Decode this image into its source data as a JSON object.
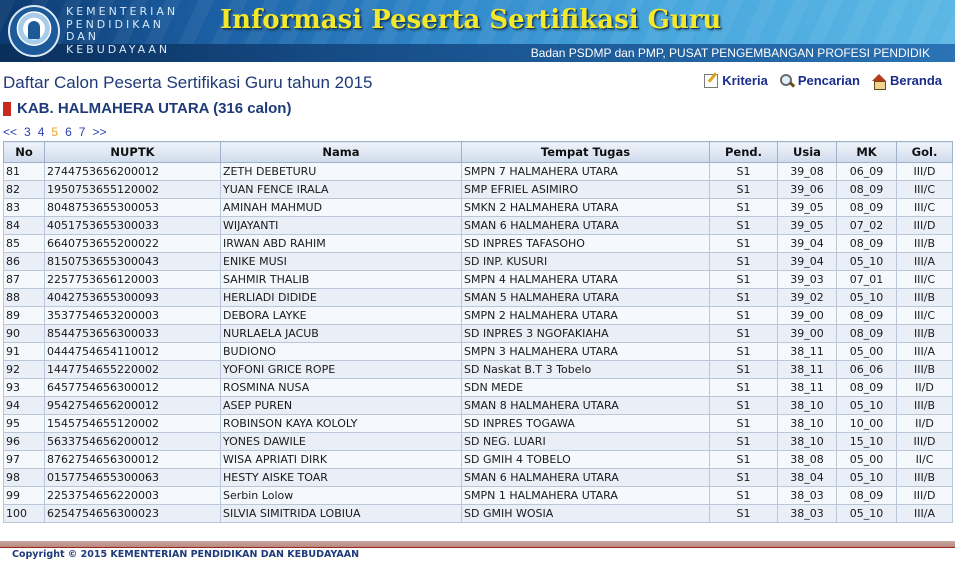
{
  "banner": {
    "ministry_lines": [
      "KEMENTERIAN",
      "PENDIDIKAN",
      "DAN",
      "KEBUDAYAAN"
    ],
    "title": "Informasi Peserta Sertifikasi Guru",
    "subtitle": "Badan PSDMP dan PMP, PUSAT PENGEMBANGAN PROFESI PENDIDIK"
  },
  "page": {
    "title": "Daftar Calon Peserta Sertifikasi Guru tahun 2015",
    "region": "KAB. HALMAHERA UTARA (316 calon)"
  },
  "nav": {
    "kriteria": "Kriteria",
    "pencarian": "Pencarian",
    "beranda": "Beranda"
  },
  "pager": {
    "prev": "<<",
    "pages": [
      "3",
      "4",
      "5",
      "6",
      "7"
    ],
    "current": "5",
    "next": ">>"
  },
  "table": {
    "headers": [
      "No",
      "NUPTK",
      "Nama",
      "Tempat Tugas",
      "Pend.",
      "Usia",
      "MK",
      "Gol."
    ],
    "rows": [
      [
        "81",
        "2744753656200012",
        "ZETH DEBETURU",
        "SMPN 7 HALMAHERA UTARA",
        "S1",
        "39_08",
        "06_09",
        "III/D"
      ],
      [
        "82",
        "1950753655120002",
        "YUAN FENCE IRALA",
        "SMP EFRIEL ASIMIRO",
        "S1",
        "39_06",
        "08_09",
        "III/C"
      ],
      [
        "83",
        "8048753655300053",
        "AMINAH MAHMUD",
        "SMKN 2 HALMAHERA UTARA",
        "S1",
        "39_05",
        "08_09",
        "III/C"
      ],
      [
        "84",
        "4051753655300033",
        "WIJAYANTI",
        "SMAN 6 HALMAHERA UTARA",
        "S1",
        "39_05",
        "07_02",
        "III/D"
      ],
      [
        "85",
        "6640753655200022",
        "IRWAN ABD RAHIM",
        "SD INPRES TAFASOHO",
        "S1",
        "39_04",
        "08_09",
        "III/B"
      ],
      [
        "86",
        "8150753655300043",
        "ENIKE MUSI",
        "SD INP. KUSURI",
        "S1",
        "39_04",
        "05_10",
        "III/A"
      ],
      [
        "87",
        "2257753656120003",
        "SAHMIR THALIB",
        "SMPN 4 HALMAHERA UTARA",
        "S1",
        "39_03",
        "07_01",
        "III/C"
      ],
      [
        "88",
        "4042753655300093",
        "HERLIADI DIDIDE",
        "SMAN 5 HALMAHERA UTARA",
        "S1",
        "39_02",
        "05_10",
        "III/B"
      ],
      [
        "89",
        "3537754653200003",
        "DEBORA LAYKE",
        "SMPN 2 HALMAHERA UTARA",
        "S1",
        "39_00",
        "08_09",
        "III/C"
      ],
      [
        "90",
        "8544753656300033",
        "NURLAELA JACUB",
        "SD INPRES 3 NGOFAKIAHA",
        "S1",
        "39_00",
        "08_09",
        "III/B"
      ],
      [
        "91",
        "0444754654110012",
        "BUDIONO",
        "SMPN 3 HALMAHERA UTARA",
        "S1",
        "38_11",
        "05_00",
        "III/A"
      ],
      [
        "92",
        "1447754655220002",
        "YOFONI GRICE ROPE",
        "SD Naskat B.T 3 Tobelo",
        "S1",
        "38_11",
        "06_06",
        "III/B"
      ],
      [
        "93",
        "6457754656300012",
        "ROSMINA NUSA",
        "SDN MEDE",
        "S1",
        "38_11",
        "08_09",
        "II/D"
      ],
      [
        "94",
        "9542754656200012",
        "ASEP PUREN",
        "SMAN 8 HALMAHERA UTARA",
        "S1",
        "38_10",
        "05_10",
        "III/B"
      ],
      [
        "95",
        "1545754655120002",
        "ROBINSON KAYA KOLOLY",
        "SD INPRES TOGAWA",
        "S1",
        "38_10",
        "10_00",
        "II/D"
      ],
      [
        "96",
        "5633754656200012",
        "YONES DAWILE",
        "SD NEG. LUARI",
        "S1",
        "38_10",
        "15_10",
        "III/D"
      ],
      [
        "97",
        "8762754656300012",
        "WISA APRIATI DIRK",
        "SD GMIH 4 TOBELO",
        "S1",
        "38_08",
        "05_00",
        "II/C"
      ],
      [
        "98",
        "0157754655300063",
        "HESTY AISKE TOAR",
        "SMAN 6 HALMAHERA UTARA",
        "S1",
        "38_04",
        "05_10",
        "III/B"
      ],
      [
        "99",
        "2253754656220003",
        "Serbin Lolow",
        "SMPN 1 HALMAHERA UTARA",
        "S1",
        "38_03",
        "08_09",
        "III/D"
      ],
      [
        "100",
        "6254754656300023",
        "SILVIA SIMITRIDA LOBIUA",
        "SD GMIH WOSIA",
        "S1",
        "38_03",
        "05_10",
        "III/A"
      ]
    ]
  },
  "footer": {
    "copyright": "Copyright © 2015 KEMENTERIAN PENDIDIKAN DAN KEBUDAYAAN"
  },
  "icons": {
    "logo": "ministry-emblem",
    "kriteria": "edit-icon",
    "pencarian": "magnifier-icon",
    "beranda": "home-icon"
  },
  "colors": {
    "title_yellow": "#f4e82c",
    "heading_blue": "#1f3a78",
    "link_blue": "#1a2c8c",
    "current_page": "#e8a317",
    "region_marker": "#c8281e"
  }
}
